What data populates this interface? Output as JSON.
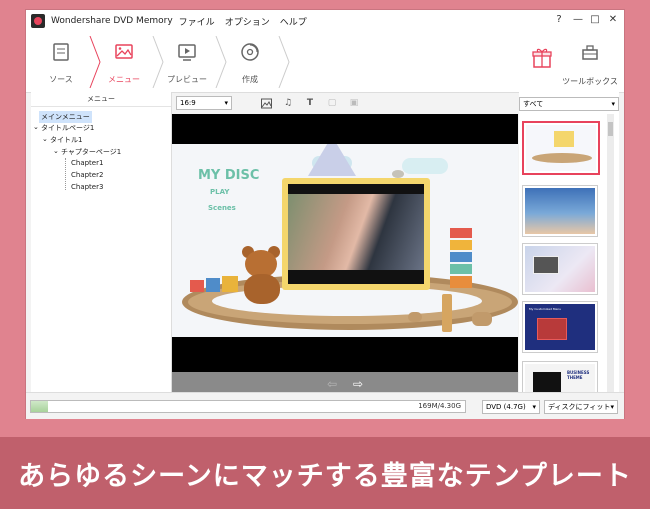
{
  "window": {
    "app_title": "Wondershare DVD Memory",
    "menus": [
      "ファイル",
      "オプション",
      "ヘルプ"
    ],
    "controls": [
      "?",
      "—",
      "□",
      "✕"
    ]
  },
  "toolbar": {
    "steps": [
      {
        "label": "ソース",
        "icon": "source-icon"
      },
      {
        "label": "メニュー",
        "icon": "menu-image-icon",
        "active": true
      },
      {
        "label": "プレビュー",
        "icon": "preview-icon"
      },
      {
        "label": "作成",
        "icon": "burn-disc-icon"
      }
    ],
    "gift_icon": "gift-icon",
    "toolbox_label": "ツールボックス"
  },
  "left_panel": {
    "header": "メニュー",
    "tree": [
      {
        "label": "メインメニュー",
        "level": 0,
        "selected": true
      },
      {
        "label": "タイトルページ1",
        "level": 0,
        "expanded": true
      },
      {
        "label": "タイトル1",
        "level": 1,
        "expanded": true
      },
      {
        "label": "チャプターページ1",
        "level": 2,
        "expanded": true
      },
      {
        "label": "Chapter1",
        "level": 3
      },
      {
        "label": "Chapter2",
        "level": 3
      },
      {
        "label": "Chapter3",
        "level": 3
      }
    ]
  },
  "center": {
    "aspect_select": "16:9",
    "tools": [
      "image-icon",
      "music-icon",
      "text-icon",
      "crop-icon",
      "save-icon"
    ],
    "scene": {
      "title": "MY DISC",
      "play": "PLAY",
      "scenes": "Scenes"
    }
  },
  "right_panel": {
    "filter": "すべて",
    "thumb5_text": "BUSINESS THEME",
    "thumb4_text": "My Customized Menu"
  },
  "status": {
    "progress_text": "169M/4.30G",
    "progress_fraction": 0.039,
    "disc_type": "DVD (4.7G)",
    "fit_mode": "ディスクにフィット"
  },
  "caption": "あらゆるシーンにマッチする豊富なテンプレート",
  "colors": {
    "accent": "#e8435c",
    "frame": "#e0838f",
    "banner": "#c0606c"
  }
}
